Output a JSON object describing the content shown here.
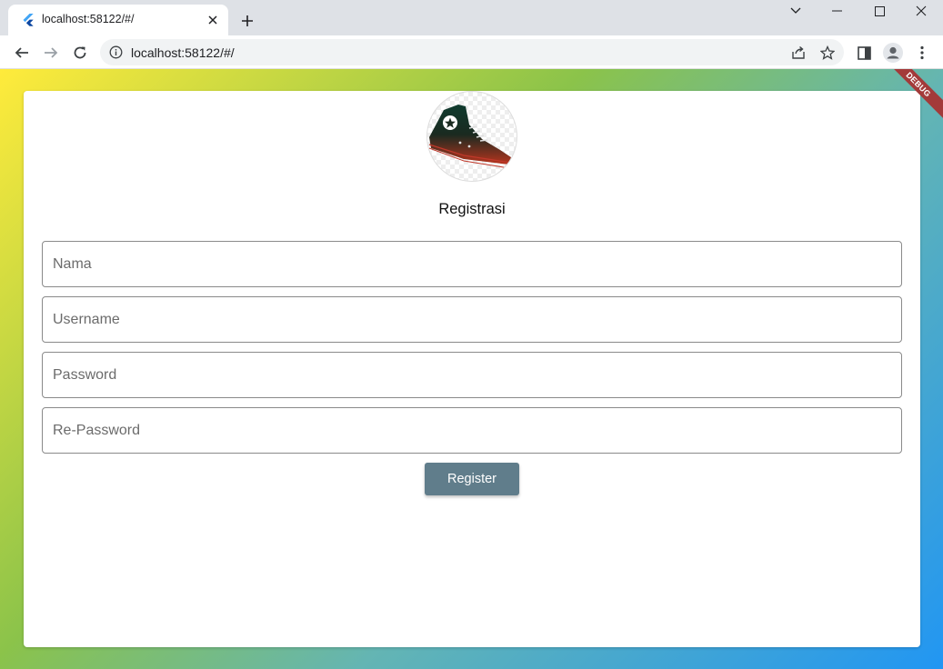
{
  "browser": {
    "tab_title": "localhost:58122/#/",
    "url": "localhost:58122/#/"
  },
  "app": {
    "form_title": "Registrasi",
    "fields": {
      "nama_placeholder": "Nama",
      "username_placeholder": "Username",
      "password_placeholder": "Password",
      "repassword_placeholder": "Re-Password"
    },
    "register_label": "Register",
    "debug_banner": "DEBUG",
    "logo": "sneaker-logo"
  },
  "colors": {
    "button": "#607d8b",
    "gradient_start": "#ffeb3b",
    "gradient_end": "#2196f3",
    "debug_banner": "#a33a3a"
  }
}
